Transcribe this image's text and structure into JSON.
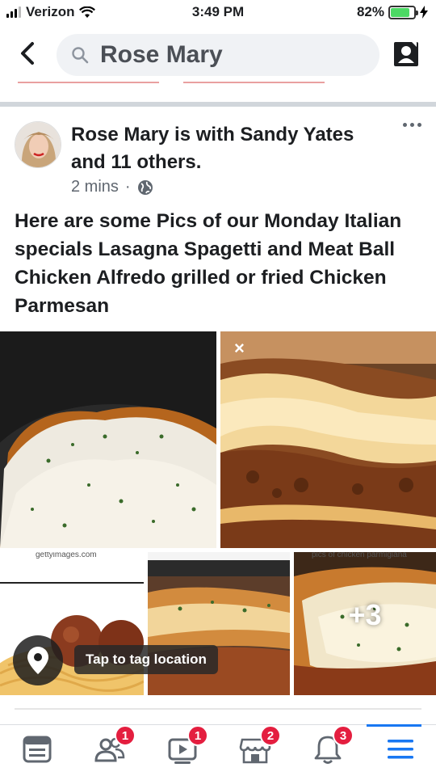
{
  "status_bar": {
    "carrier": "Verizon",
    "time": "3:49 PM",
    "battery": "82%",
    "battery_level": 0.82
  },
  "search": {
    "query": "Rose Mary"
  },
  "post": {
    "author_line": "Rose Mary is with Sandy Yates and 11 others.",
    "time_ago": "2 mins",
    "separator": "·",
    "audience_icon": "globe-icon",
    "text": "Here are some Pics of our Monday Italian specials Lasagna Spagetti and Meat Ball Chicken Alfredo grilled or fried Chicken Parmesan",
    "photos": {
      "close_glyph": "×",
      "watermark_left": "gettyimages.com",
      "watermark_right": "pics of chicken parmigiana",
      "more_count": "+3"
    },
    "tag_location": "Tap to tag location"
  },
  "bottom_nav": {
    "items": [
      {
        "icon": "news-feed-icon",
        "badge": ""
      },
      {
        "icon": "friends-icon",
        "badge": "1"
      },
      {
        "icon": "watch-icon",
        "badge": "1"
      },
      {
        "icon": "marketplace-icon",
        "badge": "2"
      },
      {
        "icon": "notifications-icon",
        "badge": "3"
      },
      {
        "icon": "menu-icon",
        "badge": ""
      }
    ]
  },
  "colors": {
    "accent": "#1877f2",
    "badge": "#e41e3f",
    "battery": "#4cd964"
  }
}
